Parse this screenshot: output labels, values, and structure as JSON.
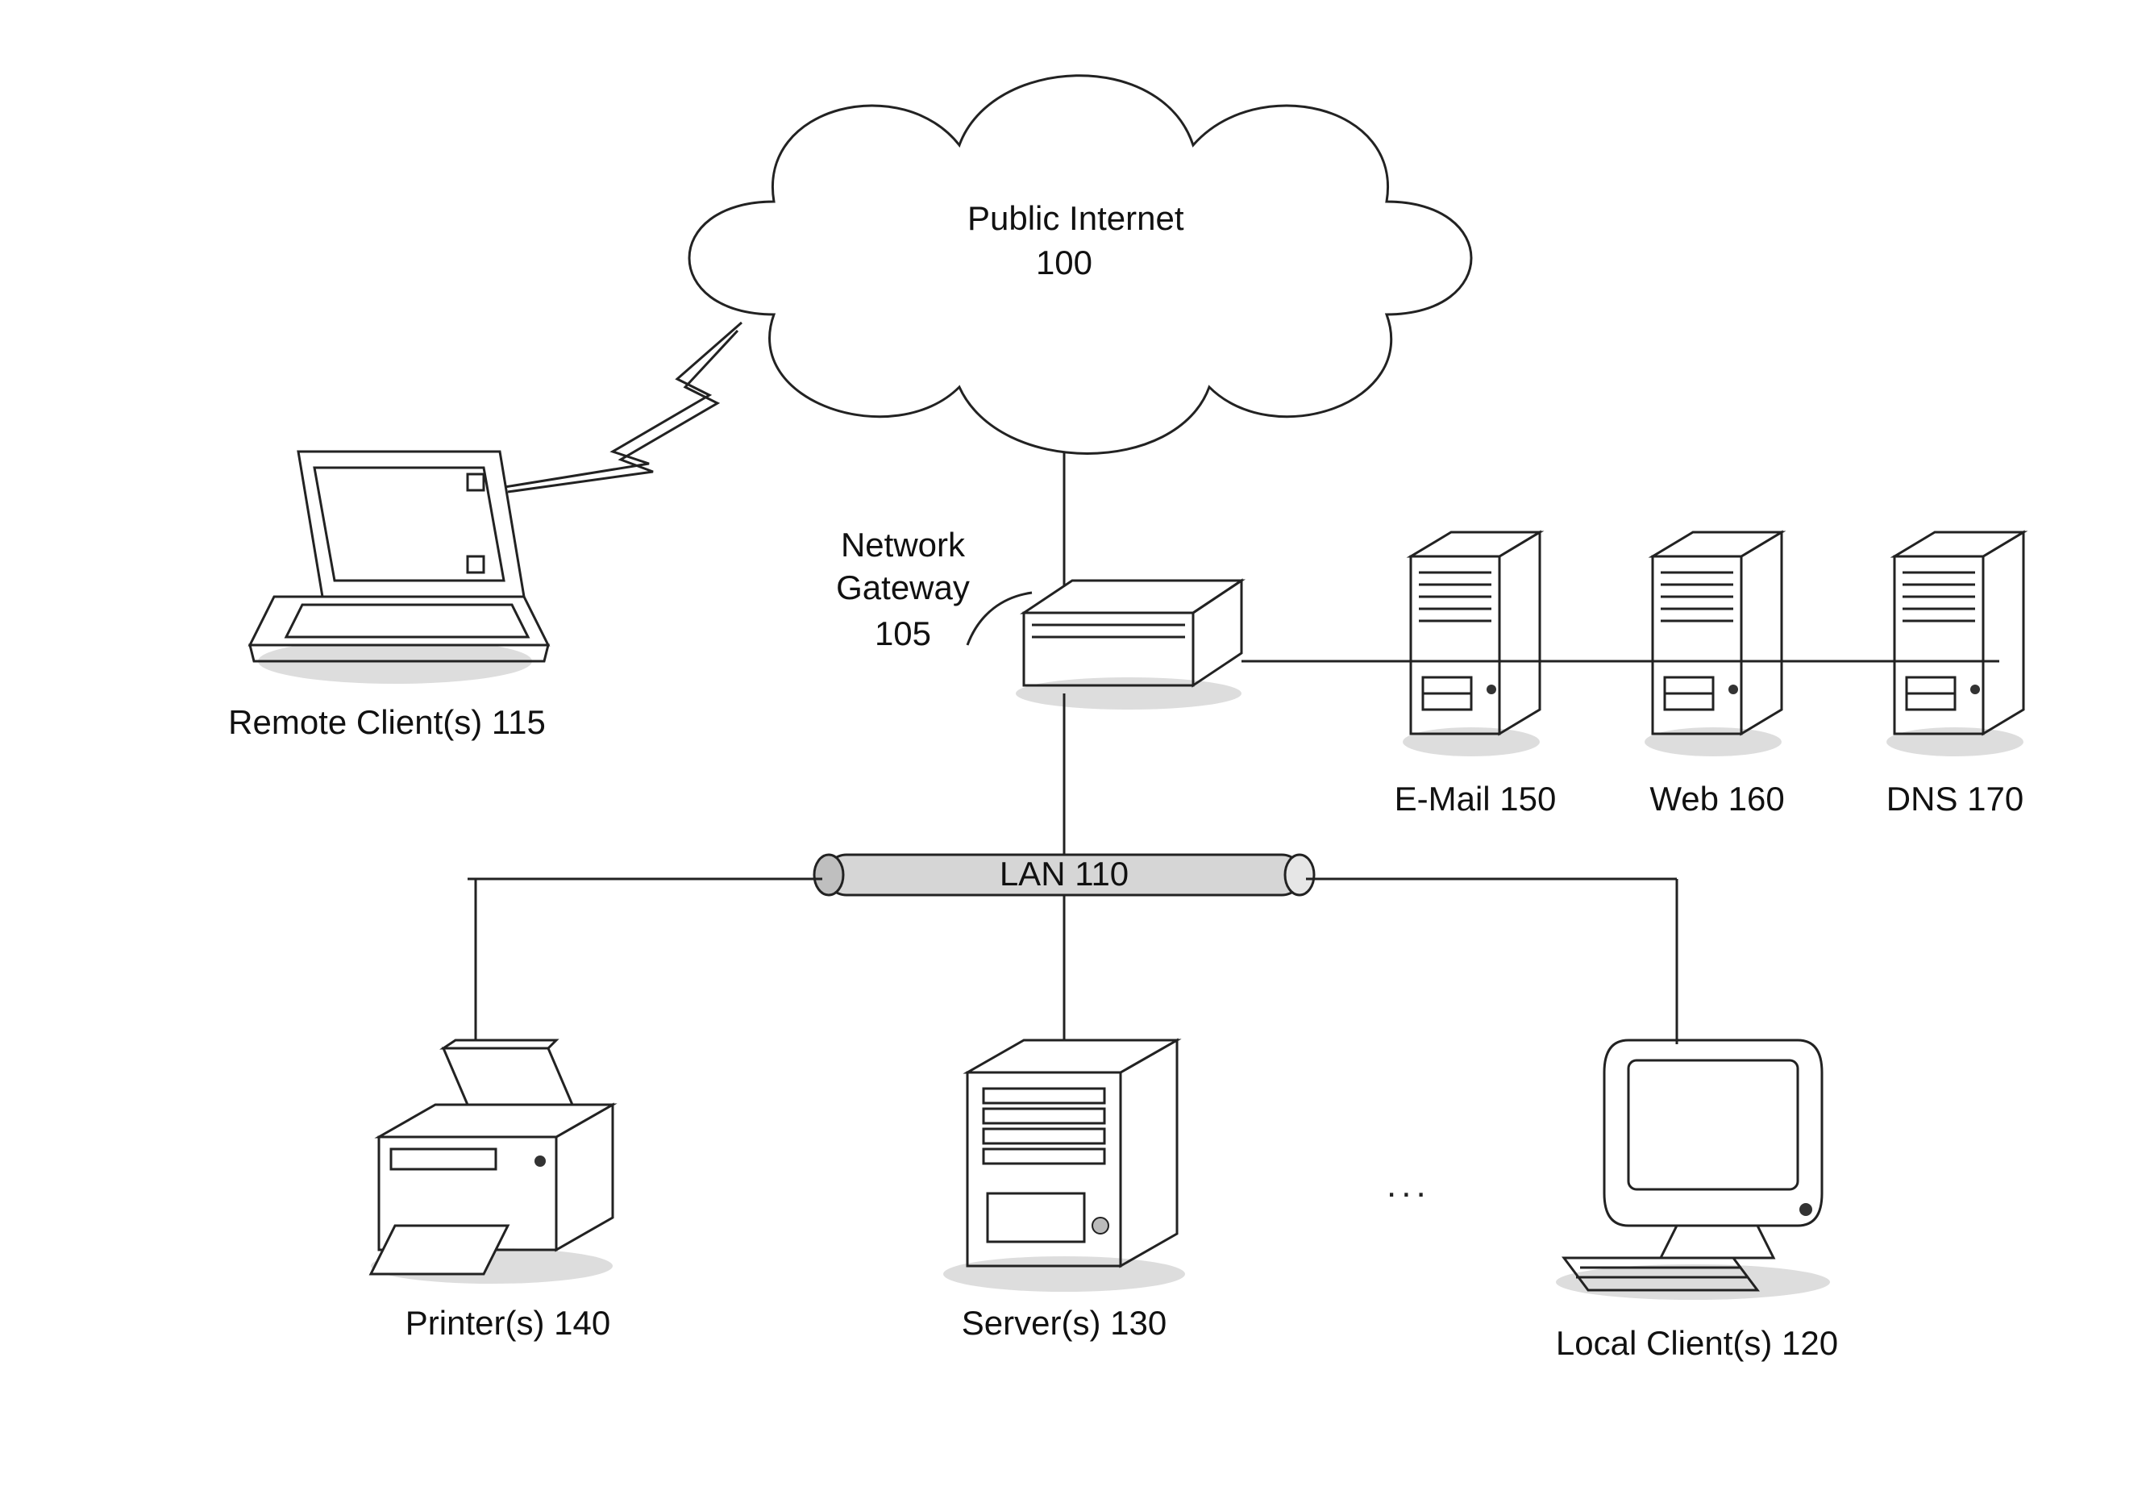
{
  "diagram": {
    "cloud": {
      "title": "Public Internet",
      "ref": "100"
    },
    "gateway": {
      "title": "Network\nGateway",
      "ref": "105"
    },
    "remoteClient": {
      "label": "Remote Client(s) 115"
    },
    "lan": {
      "label": "LAN 110"
    },
    "servers": {
      "email": {
        "label": "E-Mail 150"
      },
      "web": {
        "label": "Web 160"
      },
      "dns": {
        "label": "DNS 170"
      }
    },
    "bottom": {
      "printer": {
        "label": "Printer(s) 140"
      },
      "server": {
        "label": "Server(s) 130"
      },
      "client": {
        "label": "Local Client(s) 120"
      }
    },
    "ellipsis": "..."
  }
}
